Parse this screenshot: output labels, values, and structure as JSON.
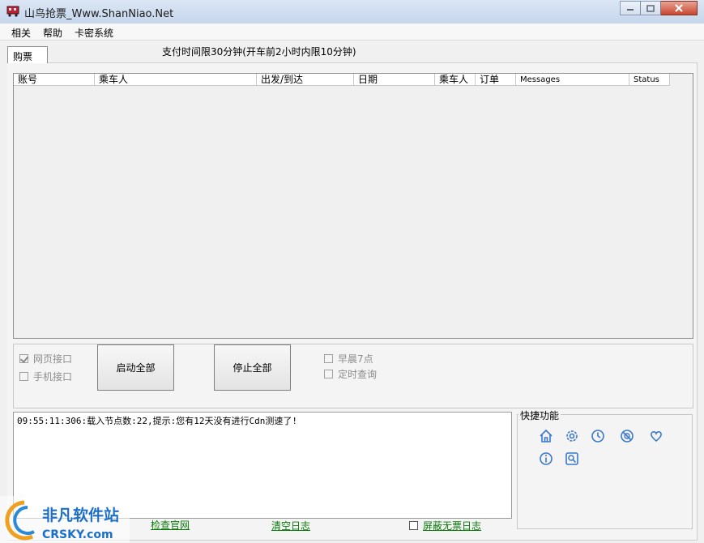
{
  "window": {
    "title": "山鸟抢票_Www.ShanNiao.Net"
  },
  "menu": [
    "相关",
    "帮助",
    "卡密系统"
  ],
  "tabs": [
    {
      "label": "购票"
    }
  ],
  "notice": "支付时间限30分钟(开车前2小时内限10分钟)",
  "table": {
    "columns": [
      "账号",
      "乘车人",
      "出发/到达",
      "日期",
      "乘车人",
      "订单",
      "Messages",
      "Status"
    ],
    "rows": []
  },
  "controls": {
    "web_api": {
      "label": "网页接口",
      "checked": true
    },
    "mobile_api": {
      "label": "手机接口",
      "checked": false
    },
    "start_all": "启动全部",
    "stop_all": "停止全部",
    "morning7": {
      "label": "早晨7点",
      "checked": false
    },
    "timed_query": {
      "label": "定时查询",
      "checked": false
    }
  },
  "log": {
    "lines": [
      "09:55:11:306:载入节点数:22,提示:您有12天没有进行Cdn测速了!"
    ]
  },
  "quick": {
    "title": "快捷功能",
    "icons": [
      "home-icon",
      "settings-icon",
      "clock-icon",
      "block-icon",
      "heart-icon",
      "info-icon",
      "search-icon"
    ]
  },
  "bottom_links": {
    "check_site": "检查官网",
    "clear_log": "清空日志",
    "hide_no_ticket": "屏蔽无票日志",
    "hide_no_ticket_checked": false
  },
  "watermark": {
    "cn": "非凡软件站",
    "en": "CRSKY.com"
  },
  "colors": {
    "link": "#0a7a0a",
    "accent_icon": "#3a78c9"
  }
}
